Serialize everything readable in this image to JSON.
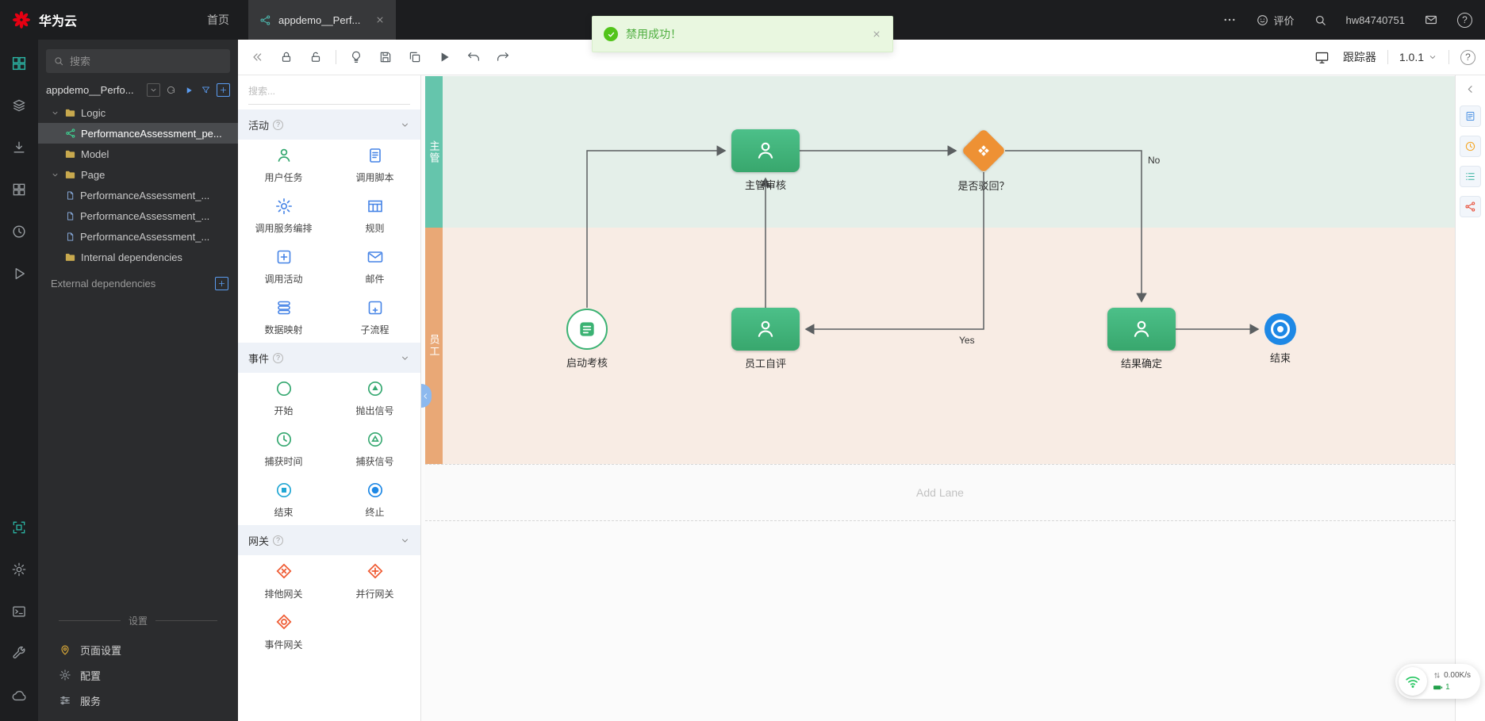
{
  "topbar": {
    "brand": "华为云",
    "home_label": "首页",
    "tab_title": "appdemo__Perf...",
    "feedback_label": "评价",
    "username": "hw84740751"
  },
  "toast": {
    "message": "禁用成功！"
  },
  "explorer": {
    "search_placeholder": "搜索",
    "project_name": "appdemo__Perfo...",
    "tree": {
      "logic": {
        "label": "Logic"
      },
      "logic_child": {
        "label": "PerformanceAssessment_pe..."
      },
      "model": {
        "label": "Model"
      },
      "page": {
        "label": "Page"
      },
      "page_children": [
        {
          "label": "PerformanceAssessment_..."
        },
        {
          "label": "PerformanceAssessment_..."
        },
        {
          "label": "PerformanceAssessment_..."
        }
      ],
      "internal": {
        "label": "Internal dependencies"
      },
      "external": {
        "label": "External dependencies"
      }
    },
    "settings_title": "设置",
    "settings_items": [
      {
        "label": "页面设置",
        "icon": "pin-icon"
      },
      {
        "label": "配置",
        "icon": "gear-icon"
      },
      {
        "label": "服务",
        "icon": "sliders-icon"
      }
    ]
  },
  "toolbar": {
    "tracker_label": "跟踪器",
    "version": "1.0.1"
  },
  "palette": {
    "search_placeholder": "搜索...",
    "sections": [
      {
        "title": "活动",
        "items": [
          {
            "label": "用户任务",
            "icon": "user-task"
          },
          {
            "label": "调用脚本",
            "icon": "call-script"
          },
          {
            "label": "调用服务编排",
            "icon": "call-service-orchestration"
          },
          {
            "label": "规则",
            "icon": "rule"
          },
          {
            "label": "调用活动",
            "icon": "call-activity"
          },
          {
            "label": "邮件",
            "icon": "email"
          },
          {
            "label": "数据映射",
            "icon": "data-mapping"
          },
          {
            "label": "子流程",
            "icon": "subprocess"
          }
        ]
      },
      {
        "title": "事件",
        "items": [
          {
            "label": "开始",
            "icon": "start-event"
          },
          {
            "label": "抛出信号",
            "icon": "throw-signal"
          },
          {
            "label": "捕获时间",
            "icon": "catch-time"
          },
          {
            "label": "捕获信号",
            "icon": "catch-signal"
          },
          {
            "label": "结束",
            "icon": "end-event"
          },
          {
            "label": "终止",
            "icon": "terminate"
          }
        ]
      },
      {
        "title": "网关",
        "items": [
          {
            "label": "排他网关",
            "icon": "exclusive-gateway"
          },
          {
            "label": "并行网关",
            "icon": "parallel-gateway"
          },
          {
            "label": "事件网关",
            "icon": "event-gateway"
          }
        ]
      }
    ]
  },
  "canvas": {
    "lanes": [
      {
        "label": "主管"
      },
      {
        "label": "员工"
      }
    ],
    "add_lane_label": "Add Lane",
    "nodes": {
      "start": {
        "label": "启动考核",
        "type": "start-event"
      },
      "review": {
        "label": "主管审核",
        "type": "user-task"
      },
      "gateway": {
        "label": "是否驳回？",
        "type": "exclusive-gateway"
      },
      "self_eval": {
        "label": "员工自评",
        "type": "user-task"
      },
      "confirm": {
        "label": "结果确定",
        "type": "user-task"
      },
      "end": {
        "label": "结束",
        "type": "end-event"
      }
    },
    "edges": [
      {
        "from": "启动考核",
        "to": "主管审核",
        "label": ""
      },
      {
        "from": "主管审核",
        "to": "是否驳回？",
        "label": ""
      },
      {
        "from": "是否驳回？",
        "to": "结果确定",
        "label": "No"
      },
      {
        "from": "是否驳回？",
        "to": "员工自评",
        "label": "Yes"
      },
      {
        "from": "员工自评",
        "to": "主管审核",
        "label": ""
      },
      {
        "from": "结果确定",
        "to": "结束",
        "label": ""
      }
    ]
  },
  "statusbar": {
    "net_speed": "0.00K/s",
    "battery_level": "1"
  },
  "colors": {
    "task_green": "#3eb378",
    "gateway_orange": "#ee9134",
    "end_blue": "#1e88e5",
    "lane1_bg": "#e4efe9",
    "lane2_bg": "#f8ece4",
    "lane1_strip": "#65c5ac",
    "lane2_strip": "#e9a876",
    "success_green": "#52c41a"
  }
}
